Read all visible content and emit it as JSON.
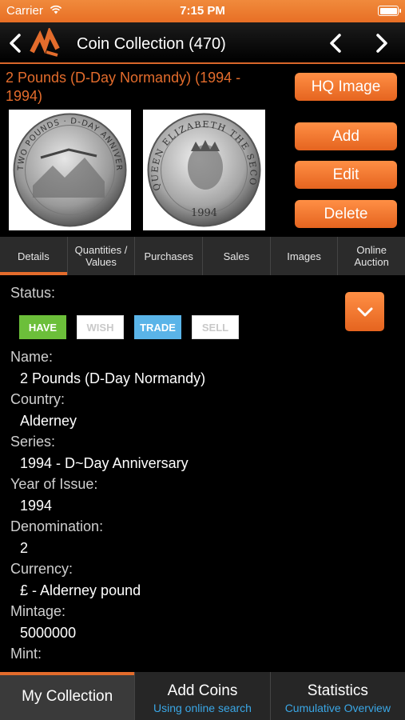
{
  "status_bar": {
    "carrier": "Carrier",
    "time": "7:15 PM"
  },
  "navbar": {
    "title": "Coin Collection (470)"
  },
  "coin": {
    "title": "2 Pounds (D-Day Normandy) (1994 - 1994)",
    "obverse_text": "TWO POUNDS · D-DAY ANNIVERSARY · ALDERNEY",
    "reverse_text": "QUEEN ELIZABETH THE SECOND",
    "reverse_year": "1994"
  },
  "buttons": {
    "hq_image": "HQ Image",
    "add": "Add",
    "edit": "Edit",
    "delete": "Delete"
  },
  "tabs": [
    {
      "label": "Details"
    },
    {
      "label": "Quantities / Values"
    },
    {
      "label": "Purchases"
    },
    {
      "label": "Sales"
    },
    {
      "label": "Images"
    },
    {
      "label": "Online Auction"
    }
  ],
  "details": {
    "status_label": "Status:",
    "status_badges": {
      "have": "HAVE",
      "wish": "WISH",
      "trade": "TRADE",
      "sell": "SELL"
    },
    "fields": [
      {
        "label": "Name:",
        "value": "2 Pounds (D-Day Normandy)"
      },
      {
        "label": "Country:",
        "value": "Alderney"
      },
      {
        "label": "Series:",
        "value": "1994 - D~Day Anniversary"
      },
      {
        "label": "Year of Issue:",
        "value": "1994"
      },
      {
        "label": "Denomination:",
        "value": "2"
      },
      {
        "label": "Currency:",
        "value": "£ - Alderney pound"
      },
      {
        "label": "Mintage:",
        "value": "5000000"
      },
      {
        "label": "Mint:",
        "value": ""
      }
    ]
  },
  "bottom_tabs": [
    {
      "title": "My Collection",
      "subtitle": ""
    },
    {
      "title": "Add Coins",
      "subtitle": "Using online search"
    },
    {
      "title": "Statistics",
      "subtitle": "Cumulative Overview"
    }
  ],
  "colors": {
    "accent": "#e36c2c",
    "have": "#6cbf3a",
    "trade": "#5ab4e8",
    "link": "#3aa7e6"
  }
}
